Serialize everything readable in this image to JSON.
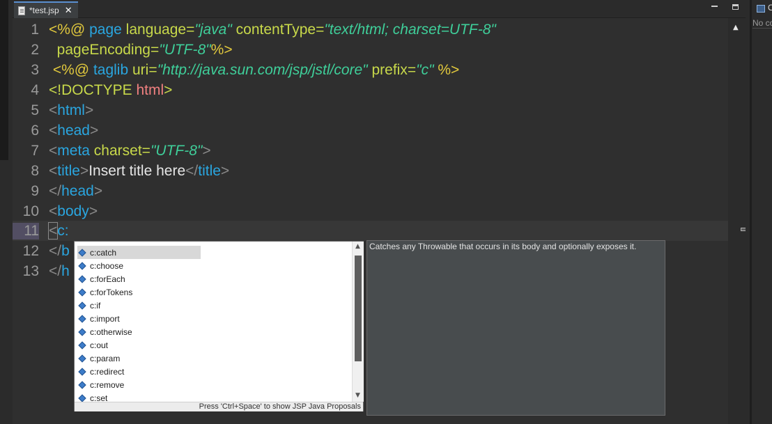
{
  "tab": {
    "title": "*test.jsp",
    "close": "✕"
  },
  "editor": {
    "lines": [
      {
        "n": "1"
      },
      {
        "n": "2"
      },
      {
        "n": "3"
      },
      {
        "n": "4"
      },
      {
        "n": "5"
      },
      {
        "n": "6"
      },
      {
        "n": "7"
      },
      {
        "n": "8"
      },
      {
        "n": "9"
      },
      {
        "n": "10"
      },
      {
        "n": "11"
      },
      {
        "n": "12"
      },
      {
        "n": "13"
      }
    ],
    "l1": {
      "open": "<%@",
      "dir": "page",
      "a1": "language",
      "eq1": "=",
      "v1": "\"java\"",
      "a2": "contentType",
      "eq2": "=",
      "v2": "\"text/html; charset=UTF-8\""
    },
    "l2": {
      "a1": "pageEncoding",
      "eq1": "=",
      "v1": "\"UTF-8\"",
      "close": "%>"
    },
    "l3": {
      "open": "<%@",
      "dir": "taglib",
      "a1": "uri",
      "eq1": "=",
      "v1": "\"http://java.sun.com/jsp/jstl/core\"",
      "a2": "prefix",
      "eq2": "=",
      "v2": "\"c\"",
      "close": "%>"
    },
    "l4": {
      "lt": "<",
      "bang": "!DOCTYPE",
      "name": "html",
      "gt": ">"
    },
    "l5": {
      "lt": "<",
      "tag": "html",
      "gt": ">"
    },
    "l6": {
      "lt": "<",
      "tag": "head",
      "gt": ">"
    },
    "l7": {
      "lt": "<",
      "tag": "meta",
      "attr": "charset",
      "eq": "=",
      "val": "\"UTF-8\"",
      "gt": ">"
    },
    "l8": {
      "lt": "<",
      "tag": "title",
      "gt": ">",
      "text": "Insert title here",
      "clt": "</",
      "ctag": "title",
      "cgt": ">"
    },
    "l9": {
      "lt": "</",
      "tag": "head",
      "gt": ">"
    },
    "l10": {
      "lt": "<",
      "tag": "body",
      "gt": ">"
    },
    "l11": {
      "lt": "<",
      "tag": "c:"
    },
    "l12": {
      "lt": "</",
      "tag": "b"
    },
    "l13": {
      "lt": "</",
      "tag": "h"
    }
  },
  "completion": {
    "items": [
      {
        "label": "c:catch",
        "icon": "tag-icon"
      },
      {
        "label": "c:choose",
        "icon": "tag-icon"
      },
      {
        "label": "c:forEach",
        "icon": "tag-icon"
      },
      {
        "label": "c:forTokens",
        "icon": "tag-icon"
      },
      {
        "label": "c:if",
        "icon": "tag-icon"
      },
      {
        "label": "c:import",
        "icon": "tag-icon"
      },
      {
        "label": "c:otherwise",
        "icon": "tag-icon"
      },
      {
        "label": "c:out",
        "icon": "tag-icon"
      },
      {
        "label": "c:param",
        "icon": "tag-icon"
      },
      {
        "label": "c:redirect",
        "icon": "tag-icon"
      },
      {
        "label": "c:remove",
        "icon": "tag-icon"
      },
      {
        "label": "c:set",
        "icon": "tag-icon"
      }
    ],
    "status": "Press 'Ctrl+Space' to show JSP Java Proposals"
  },
  "info": {
    "text": "Catches any Throwable that occurs in its body and optionally exposes it."
  },
  "right_panel": {
    "title": "O",
    "text": "No co"
  },
  "colors": {
    "accent": "#5a8fd0",
    "selected": "#d8d8d8",
    "editor_bg": "#2f2f2f"
  }
}
